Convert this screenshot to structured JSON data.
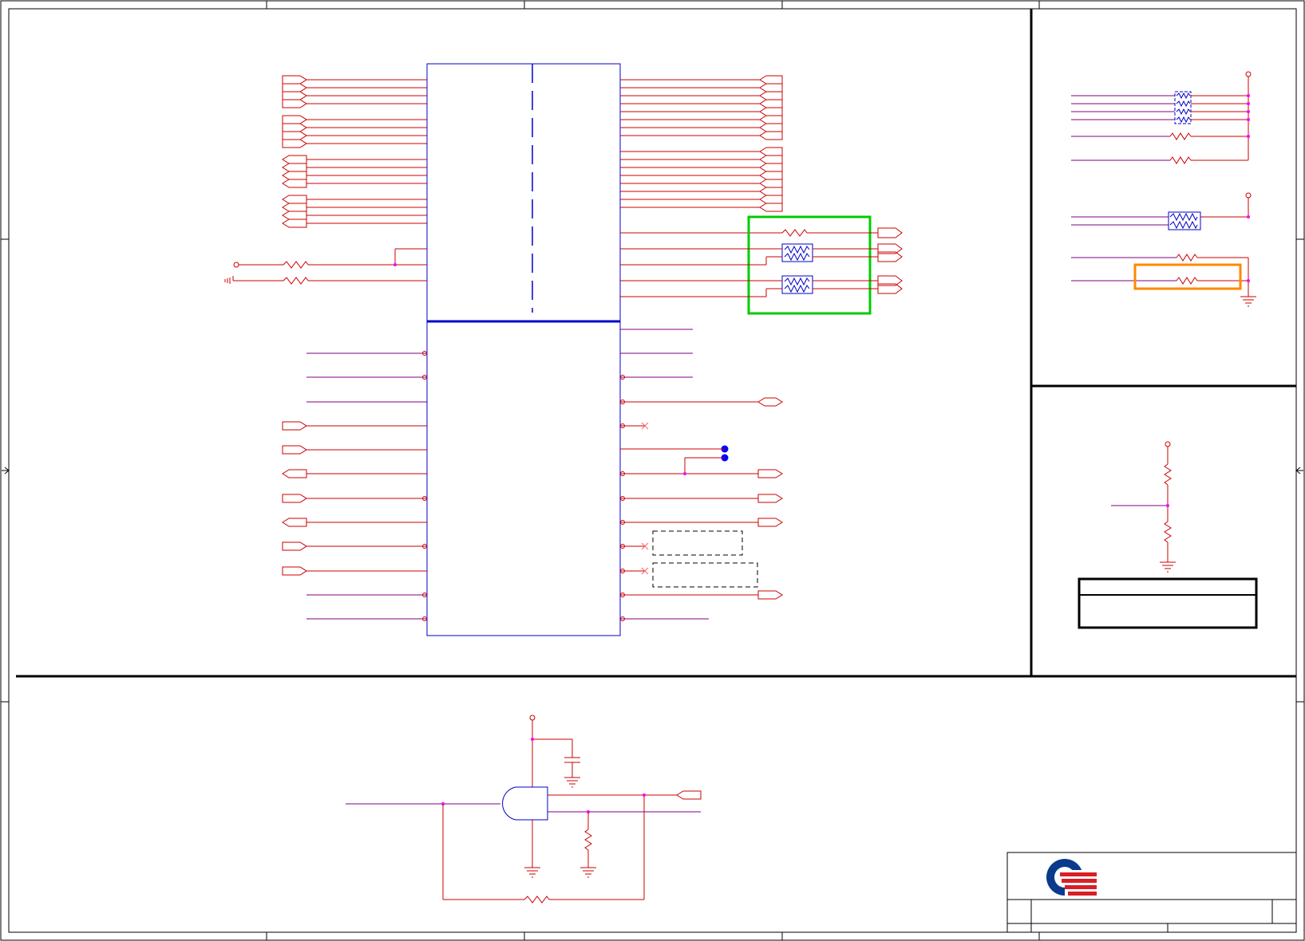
{
  "sheet": {
    "title": "",
    "frame_color": "#000000",
    "wire_color": "#cc0000",
    "net_wire_color": "#800080",
    "ic_body_color": "#0000cc",
    "junction_color": "#ff00ff",
    "no_connect_color": "#ff6666",
    "highlight_green": "#00cc00",
    "highlight_orange": "#ff8800",
    "logo_blue": "#0a3a8c",
    "logo_red": "#d81f26"
  },
  "sections": {
    "main_ic": {
      "name": ""
    },
    "pullups": {
      "name": ""
    },
    "divider": {
      "name": ""
    },
    "and_gate_circuit": {
      "name": ""
    }
  },
  "title_block": {
    "company": "",
    "title": "",
    "size": "",
    "document_number": "",
    "rev": "",
    "sheet": "",
    "date": ""
  },
  "divider_table": {
    "header": "",
    "value": ""
  },
  "icons": {
    "logo": "company-logo-icon",
    "ground": "ground-icon",
    "power": "power-rail-icon",
    "resistor": "resistor-icon",
    "capacitor": "capacitor-icon",
    "resistor_network": "resistor-network-icon",
    "and_gate": "and-gate-icon"
  }
}
